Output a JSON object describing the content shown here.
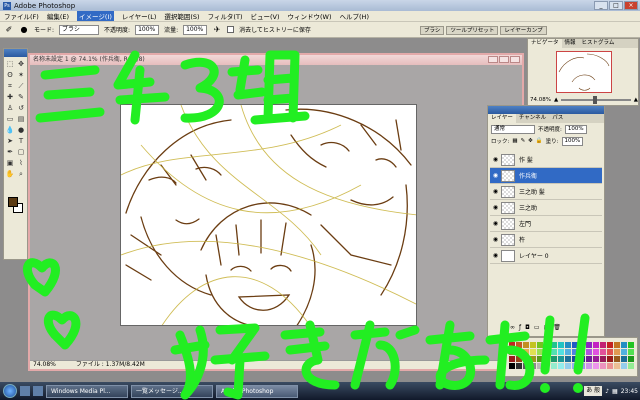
{
  "app": {
    "title": "Adobe Photoshop",
    "icon": "photoshop-icon"
  },
  "menu": [
    "ファイル(F)",
    "編集(E)",
    "イメージ(I)",
    "レイヤー(L)",
    "選択範囲(S)",
    "フィルタ(T)",
    "ビュー(V)",
    "ウィンドウ(W)",
    "ヘルプ(H)"
  ],
  "options": {
    "mode_label": "モード:",
    "mode_value": "ブラシ",
    "opacity_label": "不透明度:",
    "opacity_value": "100%",
    "flow_label": "流量:",
    "flow_value": "100%",
    "erase_history_label": "消去してヒストリーに保存"
  },
  "palette_well": [
    "ブラシ",
    "ツールプリセット",
    "レイヤーカンプ"
  ],
  "document": {
    "title": "名称未設定 1 @ 74.1% (作兵衛, RGB/8)",
    "zoom": "74.08%",
    "file_info": "ファイル : 1.37M/8.42M"
  },
  "navigator": {
    "tabs": [
      "ナビゲータ",
      "情報",
      "ヒストグラム"
    ],
    "zoom": "74.08%"
  },
  "layers": {
    "tabs": [
      "レイヤー",
      "チャンネル",
      "パス"
    ],
    "blend_mode": "通常",
    "opacity_label": "不透明度:",
    "opacity_value": "100%",
    "lock_label": "ロック:",
    "fill_label": "塗り:",
    "fill_value": "100%",
    "items": [
      {
        "name": "作 髪",
        "visible": true,
        "selected": false
      },
      {
        "name": "作兵衛",
        "visible": true,
        "selected": true
      },
      {
        "name": "三之助 髪",
        "visible": true,
        "selected": false
      },
      {
        "name": "三之助",
        "visible": true,
        "selected": false
      },
      {
        "name": "左門",
        "visible": true,
        "selected": false
      },
      {
        "name": "杵",
        "visible": true,
        "selected": false
      },
      {
        "name": "レイヤー 0",
        "visible": true,
        "selected": false
      }
    ]
  },
  "taskbar": {
    "tasks": [
      "Windows Media Pl...",
      "一覧メッセージ...",
      "Adobe Photoshop"
    ],
    "ime": "あ 般",
    "clock": "23:45"
  },
  "overlay_text": {
    "title": "三年3組",
    "message": "好きだああ！！"
  },
  "colors": {
    "overlay_green": "#22ee22",
    "selected_layer": "#316ac5",
    "foreground_swatch": "#5a3a12"
  }
}
